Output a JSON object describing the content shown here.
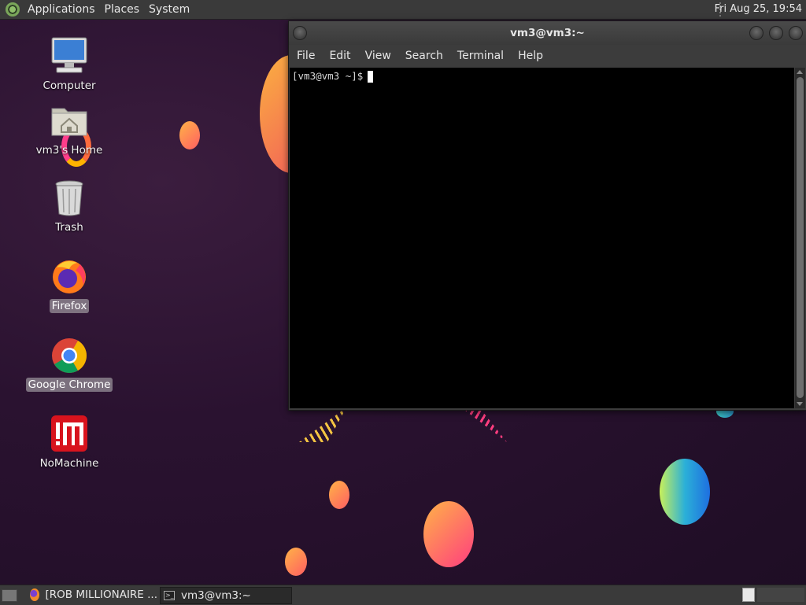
{
  "top_panel": {
    "menus": [
      "Applications",
      "Places",
      "System"
    ],
    "clock": "Fri Aug 25, 19:54"
  },
  "desktop": {
    "icons": [
      {
        "label": "Computer",
        "icon": "computer-icon",
        "selected": false
      },
      {
        "label": "vm3's Home",
        "icon": "home-folder-icon",
        "selected": false
      },
      {
        "label": "Trash",
        "icon": "trash-icon",
        "selected": false
      },
      {
        "label": "Firefox",
        "icon": "firefox-icon",
        "selected": true
      },
      {
        "label": "Google Chrome",
        "icon": "chrome-icon",
        "selected": true
      },
      {
        "label": "NoMachine",
        "icon": "nomachine-icon",
        "selected": false
      }
    ]
  },
  "terminal": {
    "title": "vm3@vm3:~",
    "menu": [
      "File",
      "Edit",
      "View",
      "Search",
      "Terminal",
      "Help"
    ],
    "prompt": "[vm3@vm3 ~]$"
  },
  "bottom_panel": {
    "tasks": [
      {
        "label": "[ROB MILLIONAIRE ...",
        "icon": "firefox-icon",
        "active": false
      },
      {
        "label": "vm3@vm3:~",
        "icon": "terminal-icon",
        "active": true
      }
    ]
  },
  "colors": {
    "panel": "#3a3a3a",
    "wallpaper": "#2a1230",
    "terminal_bg": "#000000"
  }
}
